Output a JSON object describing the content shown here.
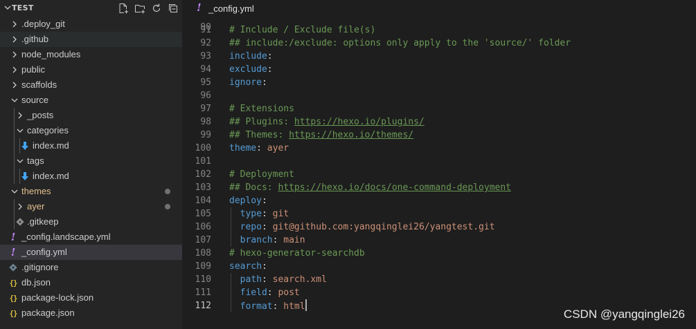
{
  "explorer": {
    "title": "TEST",
    "actions": [
      "new-file-icon",
      "new-folder-icon",
      "refresh-icon",
      "collapse-all-icon"
    ],
    "items": [
      {
        "label": ".deploy_git",
        "type": "folder",
        "expanded": false,
        "depth": 0
      },
      {
        "label": ".github",
        "type": "folder",
        "expanded": false,
        "depth": 0
      },
      {
        "label": "node_modules",
        "type": "folder",
        "expanded": false,
        "depth": 0
      },
      {
        "label": "public",
        "type": "folder",
        "expanded": false,
        "depth": 0
      },
      {
        "label": "scaffolds",
        "type": "folder",
        "expanded": false,
        "depth": 0
      },
      {
        "label": "source",
        "type": "folder",
        "expanded": true,
        "depth": 0
      },
      {
        "label": "_posts",
        "type": "folder",
        "expanded": false,
        "depth": 1
      },
      {
        "label": "categories",
        "type": "folder",
        "expanded": true,
        "depth": 1
      },
      {
        "label": "index.md",
        "type": "markdown",
        "depth": 2
      },
      {
        "label": "tags",
        "type": "folder",
        "expanded": true,
        "depth": 1
      },
      {
        "label": "index.md",
        "type": "markdown",
        "depth": 2
      },
      {
        "label": "themes",
        "type": "folder",
        "expanded": true,
        "depth": 0,
        "modified": true
      },
      {
        "label": "ayer",
        "type": "folder",
        "expanded": false,
        "depth": 1,
        "modified": true
      },
      {
        "label": ".gitkeep",
        "type": "gitkeep",
        "depth": 1
      },
      {
        "label": "_config.landscape.yml",
        "type": "yaml",
        "depth": 0
      },
      {
        "label": "_config.yml",
        "type": "yaml",
        "depth": 0,
        "selected": true
      },
      {
        "label": ".gitignore",
        "type": "gitignore",
        "depth": 0
      },
      {
        "label": "db.json",
        "type": "json",
        "depth": 0
      },
      {
        "label": "package-lock.json",
        "type": "json",
        "depth": 0
      },
      {
        "label": "package.json",
        "type": "json",
        "depth": 0
      }
    ]
  },
  "tab": {
    "label": "_config.yml",
    "icon": "yaml-icon"
  },
  "editor": {
    "top_partial_line": "90",
    "lines": [
      {
        "n": "91",
        "tokens": [
          [
            "cmt",
            "# Include / Exclude file(s)"
          ]
        ]
      },
      {
        "n": "92",
        "tokens": [
          [
            "cmt",
            "## include:/exclude: options only apply to the 'source/' folder"
          ]
        ]
      },
      {
        "n": "93",
        "tokens": [
          [
            "key",
            "include"
          ],
          [
            "pun",
            ":"
          ]
        ]
      },
      {
        "n": "94",
        "tokens": [
          [
            "key",
            "exclude"
          ],
          [
            "pun",
            ":"
          ]
        ]
      },
      {
        "n": "95",
        "tokens": [
          [
            "key",
            "ignore"
          ],
          [
            "pun",
            ":"
          ]
        ]
      },
      {
        "n": "96",
        "tokens": []
      },
      {
        "n": "97",
        "tokens": [
          [
            "cmt",
            "# Extensions"
          ]
        ]
      },
      {
        "n": "98",
        "tokens": [
          [
            "cmt",
            "## Plugins: "
          ],
          [
            "url",
            "https://hexo.io/plugins/"
          ]
        ]
      },
      {
        "n": "99",
        "tokens": [
          [
            "cmt",
            "## Themes: "
          ],
          [
            "url",
            "https://hexo.io/themes/"
          ]
        ]
      },
      {
        "n": "100",
        "tokens": [
          [
            "key",
            "theme"
          ],
          [
            "pun",
            ": "
          ],
          [
            "val",
            "ayer"
          ]
        ]
      },
      {
        "n": "101",
        "tokens": []
      },
      {
        "n": "102",
        "tokens": [
          [
            "cmt",
            "# Deployment"
          ]
        ]
      },
      {
        "n": "103",
        "tokens": [
          [
            "cmt",
            "## Docs: "
          ],
          [
            "url",
            "https://hexo.io/docs/one-command-deployment"
          ]
        ]
      },
      {
        "n": "104",
        "tokens": [
          [
            "key",
            "deploy"
          ],
          [
            "pun",
            ":"
          ]
        ]
      },
      {
        "n": "105",
        "tokens": [
          [
            "pun",
            "  "
          ],
          [
            "key",
            "type"
          ],
          [
            "pun",
            ": "
          ],
          [
            "val",
            "git"
          ]
        ]
      },
      {
        "n": "106",
        "tokens": [
          [
            "pun",
            "  "
          ],
          [
            "key",
            "repo"
          ],
          [
            "pun",
            ": "
          ],
          [
            "val",
            "git@github.com:yangqinglei26/yangtest.git"
          ]
        ]
      },
      {
        "n": "107",
        "tokens": [
          [
            "pun",
            "  "
          ],
          [
            "key",
            "branch"
          ],
          [
            "pun",
            ": "
          ],
          [
            "val",
            "main"
          ]
        ]
      },
      {
        "n": "108",
        "tokens": [
          [
            "cmt",
            "# hexo-generator-searchdb"
          ]
        ]
      },
      {
        "n": "109",
        "tokens": [
          [
            "key",
            "search"
          ],
          [
            "pun",
            ":"
          ]
        ]
      },
      {
        "n": "110",
        "tokens": [
          [
            "pun",
            "  "
          ],
          [
            "key",
            "path"
          ],
          [
            "pun",
            ": "
          ],
          [
            "val",
            "search.xml"
          ]
        ]
      },
      {
        "n": "111",
        "tokens": [
          [
            "pun",
            "  "
          ],
          [
            "key",
            "field"
          ],
          [
            "pun",
            ": "
          ],
          [
            "val",
            "post"
          ]
        ]
      },
      {
        "n": "112",
        "tokens": [
          [
            "pun",
            "  "
          ],
          [
            "key",
            "format"
          ],
          [
            "pun",
            ": "
          ],
          [
            "val",
            "html"
          ]
        ],
        "active": true
      }
    ]
  },
  "watermark": "CSDN @yangqinglei26",
  "colors": {
    "sidebar_bg": "#252526",
    "editor_bg": "#1e1e1e",
    "selected_row": "#37373d",
    "comment": "#6a9955",
    "key": "#569cd6",
    "string": "#ce9178",
    "yaml_icon": "#c586f9",
    "json_icon": "#d7ba3d",
    "markdown_icon": "#42a5f5"
  }
}
